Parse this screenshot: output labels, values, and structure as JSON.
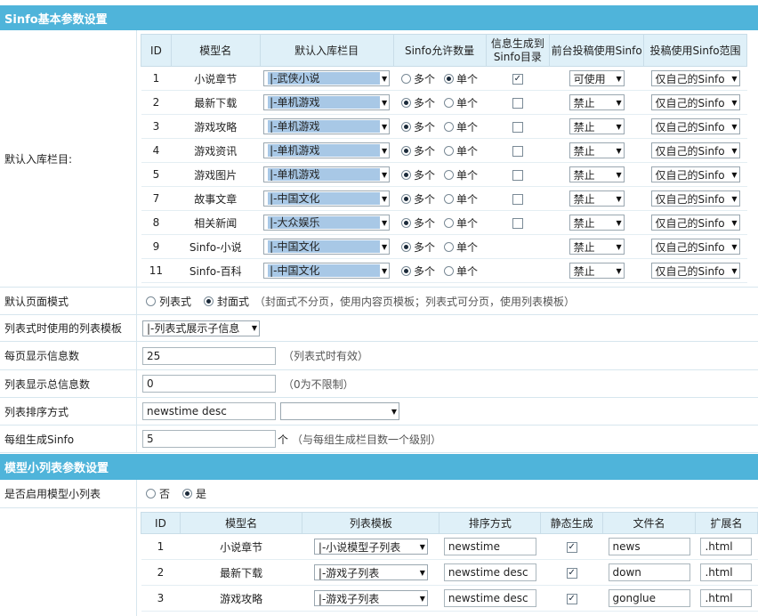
{
  "section1": {
    "title": "Sinfo基本参数设置"
  },
  "default_columns": {
    "label": "默认入库栏目:",
    "headers": [
      "ID",
      "模型名",
      "默认入库栏目",
      "Sinfo允许数量",
      "信息生成到Sinfo目录",
      "前台投稿使用Sinfo",
      "投稿使用Sinfo范围"
    ],
    "many_label": "多个",
    "single_label": "单个",
    "rows": [
      {
        "id": "1",
        "model": "小说章节",
        "column": "|-武侠小说",
        "allow": "single",
        "gen": "checked",
        "front": "可使用",
        "scope": "仅自己的Sinfo"
      },
      {
        "id": "2",
        "model": "最新下载",
        "column": "|-单机游戏",
        "allow": "many",
        "gen": "unchecked",
        "front": "禁止",
        "scope": "仅自己的Sinfo"
      },
      {
        "id": "3",
        "model": "游戏攻略",
        "column": "|-单机游戏",
        "allow": "many",
        "gen": "unchecked",
        "front": "禁止",
        "scope": "仅自己的Sinfo"
      },
      {
        "id": "4",
        "model": "游戏资讯",
        "column": "|-单机游戏",
        "allow": "many",
        "gen": "unchecked",
        "front": "禁止",
        "scope": "仅自己的Sinfo"
      },
      {
        "id": "5",
        "model": "游戏图片",
        "column": "|-单机游戏",
        "allow": "many",
        "gen": "unchecked",
        "front": "禁止",
        "scope": "仅自己的Sinfo"
      },
      {
        "id": "7",
        "model": "故事文章",
        "column": "|-中国文化",
        "allow": "many",
        "gen": "unchecked",
        "front": "禁止",
        "scope": "仅自己的Sinfo"
      },
      {
        "id": "8",
        "model": "相关新闻",
        "column": "|-大众娱乐",
        "allow": "many",
        "gen": "unchecked",
        "front": "禁止",
        "scope": "仅自己的Sinfo"
      },
      {
        "id": "9",
        "model": "Sinfo-小说",
        "column": "|-中国文化",
        "allow": "many",
        "gen": "none",
        "front": "禁止",
        "scope": "仅自己的Sinfo"
      },
      {
        "id": "11",
        "model": "Sinfo-百科",
        "column": "|-中国文化",
        "allow": "many",
        "gen": "none",
        "front": "禁止",
        "scope": "仅自己的Sinfo"
      }
    ]
  },
  "page_mode": {
    "label": "默认页面模式",
    "option_list": "列表式",
    "option_cover": "封面式",
    "selected": "cover",
    "hint": "（封面式不分页，使用内容页模板；列表式可分页，使用列表模板）"
  },
  "list_template": {
    "label": "列表式时使用的列表模板",
    "value": "|-列表式展示子信息"
  },
  "per_page": {
    "label": "每页显示信息数",
    "value": "25",
    "hint": "（列表式时有效）"
  },
  "total_count": {
    "label": "列表显示总信息数",
    "value": "0",
    "hint": "（0为不限制）"
  },
  "sort": {
    "label": "列表排序方式",
    "value": "newstime desc",
    "select_value": ""
  },
  "group_gen": {
    "label": "每组生成Sinfo",
    "value": "5",
    "unit": "个",
    "hint": "（与每组生成栏目数一个级别）"
  },
  "section2": {
    "title": "模型小列表参数设置"
  },
  "enable_small_list": {
    "label": "是否启用模型小列表",
    "option_no": "否",
    "option_yes": "是",
    "selected": "yes"
  },
  "small_list": {
    "headers": [
      "ID",
      "模型名",
      "列表模板",
      "排序方式",
      "静态生成",
      "文件名",
      "扩展名"
    ],
    "rows": [
      {
        "id": "1",
        "model": "小说章节",
        "template": "|-小说模型子列表",
        "sort": "newstime",
        "static": true,
        "filename": "news",
        "ext": ".html"
      },
      {
        "id": "2",
        "model": "最新下载",
        "template": "|-游戏子列表",
        "sort": "newstime desc",
        "static": true,
        "filename": "down",
        "ext": ".html"
      },
      {
        "id": "3",
        "model": "游戏攻略",
        "template": "|-游戏子列表",
        "sort": "newstime desc",
        "static": true,
        "filename": "gonglue",
        "ext": ".html"
      }
    ]
  },
  "colors": {
    "section_bar": "#4fb4da",
    "header_bg": "#dff0f8",
    "select_highlight": "#a8c8e6"
  },
  "icons": {
    "radio": "radio-button",
    "checkbox": "checkbox",
    "dropdown": "chevron-down-icon"
  }
}
